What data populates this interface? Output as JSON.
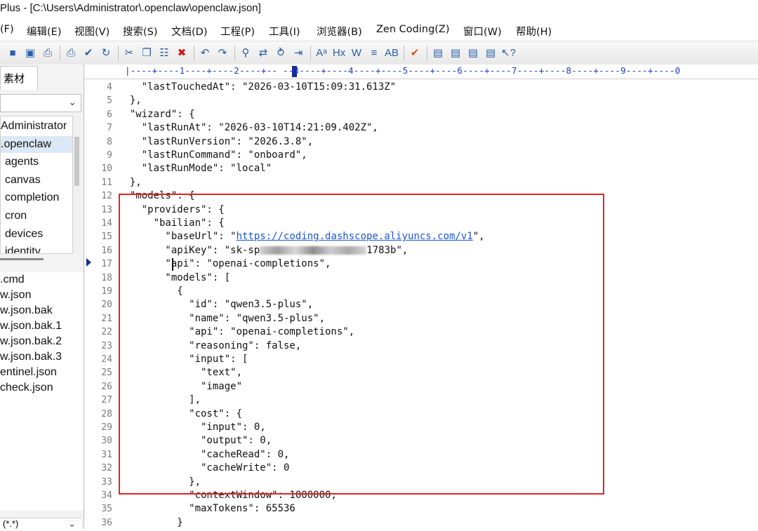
{
  "window": {
    "title": "Plus - [C:\\Users\\Administrator\\.openclaw\\openclaw.json]"
  },
  "menu": [
    "F(F)",
    "编辑(E)",
    "视图(V)",
    "搜索(S)",
    "文档(D)",
    "工程(P)",
    "工具(T)",
    "浏览器(B)",
    "Zen Coding(Z)",
    "窗口(W)",
    "帮助(H)"
  ],
  "menu_display": [
    "(F)",
    "编辑(E)",
    "视图(V)",
    "搜索(S)",
    "文档(D)",
    "工程(P)",
    "工具(I)",
    "浏览器(B)",
    "Zen Coding(Z)",
    "窗口(W)",
    "帮助(H)"
  ],
  "toolbar_icons": [
    "save-icon",
    "save-all-icon",
    "print-preview-icon",
    "print-icon",
    "spell-check-icon",
    "browser-view-icon",
    "cut-icon",
    "copy-icon",
    "paste-icon",
    "delete-icon",
    "undo-icon",
    "redo-icon",
    "find-icon",
    "replace-icon",
    "find-in-files-icon",
    "goto-icon",
    "font-size-icon",
    "hex-icon",
    "word-wrap-icon",
    "line-wrap-icon",
    "column-mode-icon",
    "check-icon",
    "panel-icon",
    "panel2-icon",
    "panel3-icon",
    "panel4-icon",
    "help-pointer-icon"
  ],
  "toolbar_glyphs": [
    "■",
    "▣",
    "⎙",
    "⎙",
    "✔",
    "↻",
    "✂",
    "❐",
    "☷",
    "✖",
    "↶",
    "↷",
    "⚲",
    "⇄",
    "⥁",
    "⇥",
    "Aᵃ",
    "Hx",
    "W",
    "≡",
    "AB",
    "✔",
    "▤",
    "▤",
    "▤",
    "▤",
    "↖?"
  ],
  "left_panel": {
    "tab": "素材",
    "tree": [
      {
        "label": "Administrator",
        "selected": false
      },
      {
        "label": ".openclaw",
        "selected": true
      },
      {
        "label": "agents",
        "selected": false
      },
      {
        "label": "canvas",
        "selected": false
      },
      {
        "label": "completion",
        "selected": false
      },
      {
        "label": "cron",
        "selected": false
      },
      {
        "label": "devices",
        "selected": false
      },
      {
        "label": "identity",
        "selected": false
      }
    ],
    "files": [
      ".cmd",
      "w.json",
      "w.json.bak",
      "w.json.bak.1",
      "w.json.bak.2",
      "w.json.bak.3",
      "entinel.json",
      "check.json"
    ],
    "filter": "(*.*)"
  },
  "ruler": "|----+----1----+----2----+-- --3----+----4----+----5----+----6----+----7----+----8----+----9----+----0",
  "code_lines": [
    {
      "n": "4",
      "text": "    \"lastTouchedAt\": \"2026-03-10T15:09:31.613Z\""
    },
    {
      "n": "5",
      "text": "  },"
    },
    {
      "n": "6",
      "text": "  \"wizard\": {"
    },
    {
      "n": "7",
      "text": "    \"lastRunAt\": \"2026-03-10T14:21:09.402Z\","
    },
    {
      "n": "8",
      "text": "    \"lastRunVersion\": \"2026.3.8\","
    },
    {
      "n": "9",
      "text": "    \"lastRunCommand\": \"onboard\","
    },
    {
      "n": "10",
      "text": "    \"lastRunMode\": \"local\""
    },
    {
      "n": "11",
      "text": "  },"
    },
    {
      "n": "12",
      "text": "  \"models\": {"
    },
    {
      "n": "13",
      "text": "    \"providers\": {"
    },
    {
      "n": "14",
      "text": "      \"bailian\": {"
    },
    {
      "n": "15",
      "pre": "        \"baseUrl\": \"",
      "link": "https://coding.dashscope.aliyuncs.com/v1",
      "post": "\","
    },
    {
      "n": "16",
      "pre": "        \"apiKey\": \"sk-sp",
      "blur": true,
      "post": "1783b\","
    },
    {
      "n": "17",
      "text": "        \"api\": \"openai-completions\","
    },
    {
      "n": "18",
      "text": "        \"models\": ["
    },
    {
      "n": "19",
      "text": "          {"
    },
    {
      "n": "20",
      "text": "            \"id\": \"qwen3.5-plus\","
    },
    {
      "n": "21",
      "text": "            \"name\": \"qwen3.5-plus\","
    },
    {
      "n": "22",
      "text": "            \"api\": \"openai-completions\","
    },
    {
      "n": "23",
      "text": "            \"reasoning\": false,"
    },
    {
      "n": "24",
      "text": "            \"input\": ["
    },
    {
      "n": "25",
      "text": "              \"text\","
    },
    {
      "n": "26",
      "text": "              \"image\""
    },
    {
      "n": "27",
      "text": "            ],"
    },
    {
      "n": "28",
      "text": "            \"cost\": {"
    },
    {
      "n": "29",
      "text": "              \"input\": 0,"
    },
    {
      "n": "30",
      "text": "              \"output\": 0,"
    },
    {
      "n": "31",
      "text": "              \"cacheRead\": 0,"
    },
    {
      "n": "32",
      "text": "              \"cacheWrite\": 0"
    },
    {
      "n": "33",
      "text": "            },"
    },
    {
      "n": "34",
      "text": "            \"contextWindow\": 1000000,"
    },
    {
      "n": "35",
      "text": "            \"maxTokens\": 65536"
    },
    {
      "n": "36",
      "text": "          }"
    }
  ],
  "colors": {
    "highlight_box": "#e02424",
    "link": "#1a56d6",
    "ruler": "#1a3cc8"
  }
}
